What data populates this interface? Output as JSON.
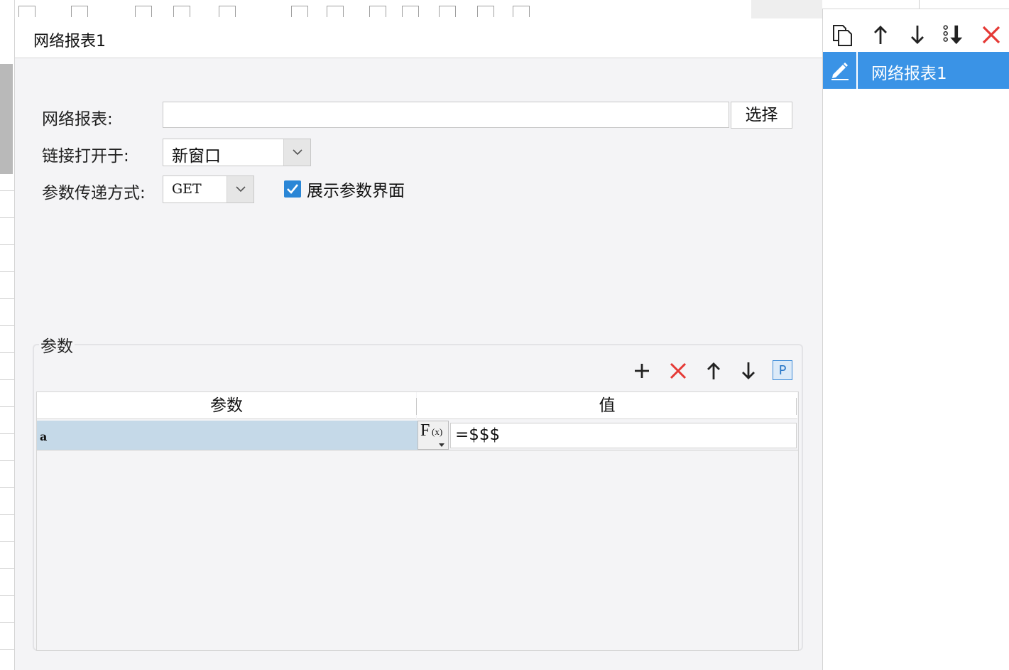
{
  "dialog": {
    "title": "网络报表1"
  },
  "form": {
    "report_label": "网络报表:",
    "report_value": "",
    "select_button": "选择",
    "open_in_label": "链接打开于:",
    "open_in_value": "新窗口",
    "method_label": "参数传递方式:",
    "method_value": "GET",
    "show_params_label": "展示参数界面",
    "show_params_checked": true
  },
  "params": {
    "legend": "参数",
    "columns": [
      "参数",
      "值"
    ],
    "rows": [
      {
        "name": "a",
        "value": "=$$$"
      }
    ],
    "toolbar_icons": [
      "add-icon",
      "delete-icon",
      "move-up-icon",
      "move-down-icon",
      "parameter-p-icon"
    ]
  },
  "right_panel": {
    "toolbar_icons": [
      "copy-icon",
      "move-up-icon",
      "move-down-icon",
      "sort-icon",
      "delete-icon"
    ],
    "items": [
      {
        "label": "网络报表1",
        "selected": true
      }
    ]
  },
  "colors": {
    "accent": "#3a93e6",
    "delete": "#e53935",
    "selected_row": "#c5d9e8",
    "checkbox": "#2a86d6"
  }
}
